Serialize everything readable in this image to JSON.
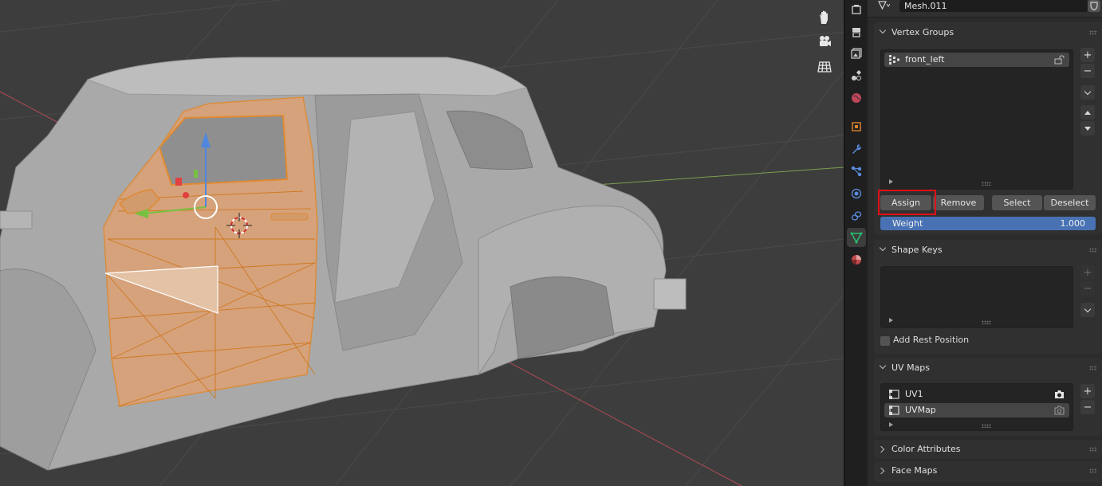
{
  "object_data": {
    "mesh_name": "Mesh.011"
  },
  "vertex_groups": {
    "title": "Vertex Groups",
    "items": [
      {
        "name": "front_left",
        "selected": true
      }
    ],
    "buttons": {
      "assign": "Assign",
      "remove": "Remove",
      "select": "Select",
      "deselect": "Deselect"
    },
    "weight_label": "Weight",
    "weight_value": "1.000"
  },
  "shape_keys": {
    "title": "Shape Keys",
    "add_rest_position": "Add Rest Position",
    "add_rest_position_checked": false
  },
  "uv_maps": {
    "title": "UV Maps",
    "items": [
      {
        "name": "UV1",
        "active_render": true,
        "selected": false
      },
      {
        "name": "UVMap",
        "active_render": false,
        "selected": true
      }
    ]
  },
  "collapsed_panels": [
    "Color Attributes",
    "Face Maps"
  ],
  "properties_tabs": [
    "render-icon",
    "output-icon",
    "view-layer-icon",
    "scene-icon",
    "world-icon",
    "object-icon",
    "modifier-icon",
    "particles-icon",
    "physics-icon",
    "constraints-icon",
    "object-data-icon",
    "material-icon"
  ],
  "active_tab": "object-data-icon",
  "viewport_tools": [
    "hand-pan-icon",
    "camera-view-icon",
    "grid-icon"
  ],
  "colors": {
    "selection_orange": "#e08a32",
    "weight_blue": "#4872b4",
    "highlight_red": "#e0101a",
    "active_data_tab": "#26c26e"
  }
}
